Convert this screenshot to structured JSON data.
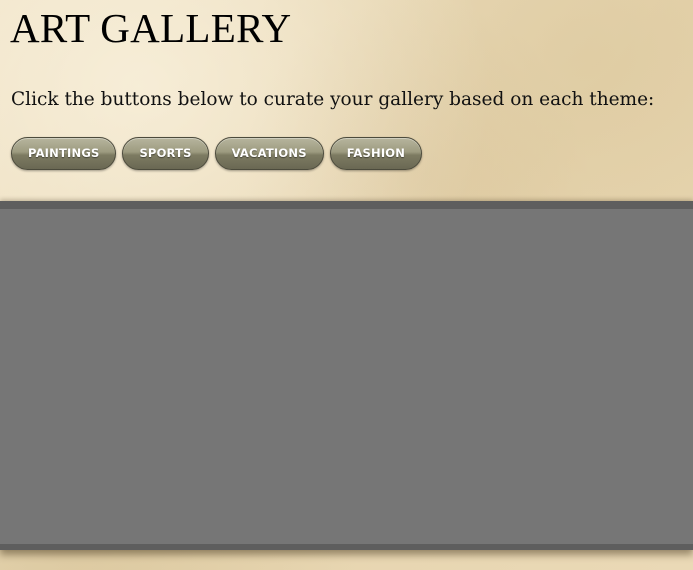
{
  "header": {
    "title": "ART GALLERY",
    "instructions": "Click the buttons below to curate your gallery based on each theme:"
  },
  "themes": [
    {
      "label": "PAINTINGS"
    },
    {
      "label": "SPORTS"
    },
    {
      "label": "VACATIONS"
    },
    {
      "label": "FASHION"
    }
  ],
  "colors": {
    "page_background": "#ebdcbc",
    "button_gradient_top": "#b7b59d",
    "button_gradient_bottom": "#6a6853",
    "button_text": "#ffffff",
    "gallery_background": "#767676",
    "gallery_border": "#5e5e5e"
  }
}
